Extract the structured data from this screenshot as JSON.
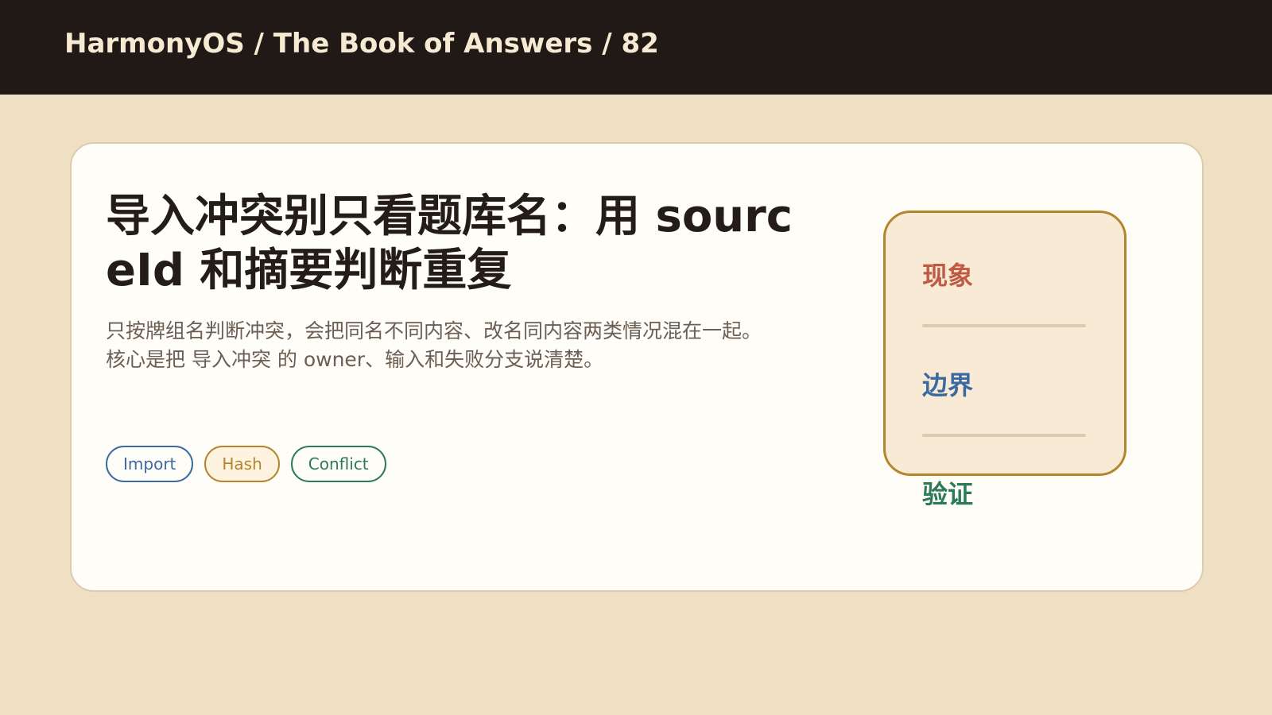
{
  "header": {
    "breadcrumb": "HarmonyOS / The Book of Answers / 82"
  },
  "card": {
    "title": "导入冲突别只看题库名：用 sourceId 和摘要判断重复",
    "description_line1": "只按牌组名判断冲突，会把同名不同内容、改名同内容两类情况混在一起。",
    "description_line2": "核心是把 导入冲突 的 owner、输入和失败分支说清楚。",
    "tags": [
      {
        "label": "Import",
        "color": "#3b6aa0"
      },
      {
        "label": "Hash",
        "color": "#b5852b"
      },
      {
        "label": "Conflict",
        "color": "#2d7a59"
      }
    ]
  },
  "side_panel": {
    "items": [
      {
        "label": "现象",
        "color": "#bf5a45"
      },
      {
        "label": "边界",
        "color": "#3b6aa0"
      },
      {
        "label": "验证",
        "color": "#2d7a59"
      }
    ]
  },
  "colors": {
    "background": "#efe0c3",
    "topbar": "#211915",
    "card": "#fffdf8",
    "accent_gold": "#b5852b"
  }
}
